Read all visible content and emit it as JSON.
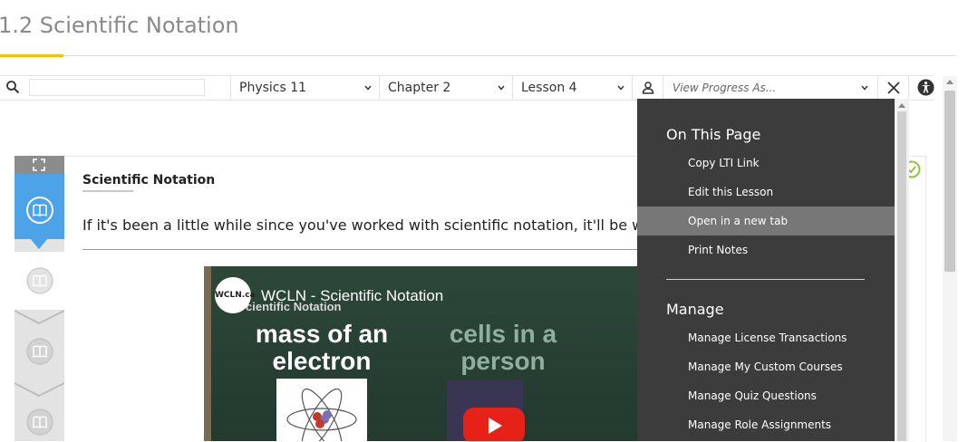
{
  "page": {
    "title": "1.2 Scientific Notation"
  },
  "toolbar": {
    "search_value": "",
    "course": "Physics 11",
    "chapter": "Chapter 2",
    "lesson": "Lesson 4",
    "progress_placeholder": "View Progress As..."
  },
  "card": {
    "heading": "Scientific Notation",
    "intro": "If it's been a little while since you've worked with scientific notation, it'll be worth w"
  },
  "video": {
    "logo": "WCLN.ca",
    "title": "WCLN - Scientific Notation",
    "subtitle": "cientific Notation",
    "left_text": "mass of an electron",
    "right_text": "cells in a person"
  },
  "menu": {
    "on_this_page": {
      "heading": "On This Page",
      "items": [
        "Copy LTI Link",
        "Edit this Lesson",
        "Open in a new tab",
        "Print Notes"
      ],
      "highlighted_item": "Open in a new tab"
    },
    "manage": {
      "heading": "Manage",
      "items": [
        "Manage License Transactions",
        "Manage My Custom Courses",
        "Manage Quiz Questions",
        "Manage Role Assignments"
      ]
    }
  },
  "icons": {
    "search": "search-icon",
    "person": "person-icon",
    "close": "close-icon",
    "accessibility": "accessibility-icon",
    "expand": "expand-icon",
    "book": "book-icon",
    "check": "check-circle-icon"
  },
  "colors": {
    "accent_yellow": "#f2c200",
    "active_step": "#4da3e8",
    "menu_bg": "#3c3c3c",
    "menu_hover": "#777777",
    "check_green": "#8dc63f"
  }
}
